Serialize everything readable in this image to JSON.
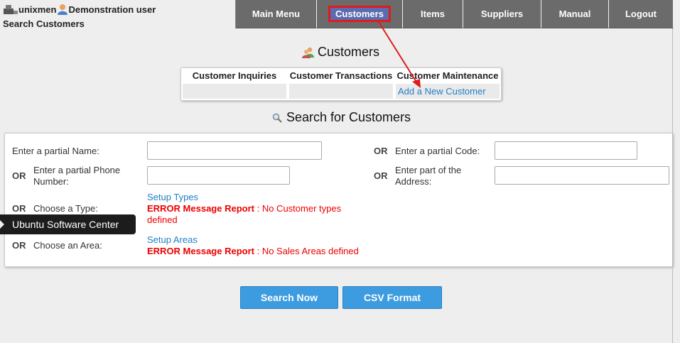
{
  "header": {
    "company": "unixmen",
    "user": "Demonstration user",
    "page_title": "Search Customers"
  },
  "menu": [
    {
      "label": "Main Menu"
    },
    {
      "label": "Customers",
      "highlighted": true
    },
    {
      "label": "Items"
    },
    {
      "label": "Suppliers"
    },
    {
      "label": "Manual"
    },
    {
      "label": "Logout"
    }
  ],
  "customers_panel": {
    "title": "Customers",
    "columns": [
      {
        "header": "Customer Inquiries",
        "cell": ""
      },
      {
        "header": "Customer Transactions",
        "cell": ""
      },
      {
        "header": "Customer Maintenance",
        "cell": "Add a New Customer"
      }
    ]
  },
  "search": {
    "title": "Search for Customers",
    "or_label": "OR",
    "name_label": "Enter a partial Name:",
    "code_label": "Enter a partial Code:",
    "phone_label": "Enter a partial Phone Number:",
    "address_label": "Enter part of the Address:",
    "type_label": "Choose a Type:",
    "type_link": "Setup Types",
    "type_error_title": "ERROR Message Report",
    "type_error_text": " : No Customer types defined",
    "area_label": "Choose an Area:",
    "area_link": "Setup Areas",
    "area_error_title": "ERROR Message Report",
    "area_error_text": " : No Sales Areas defined",
    "name_value": "",
    "code_value": "",
    "phone_value": "",
    "address_value": ""
  },
  "tooltip": "Ubuntu Software Center",
  "buttons": {
    "search_now": "Search Now",
    "csv_format": "CSV Format"
  },
  "colors": {
    "menu_bg": "#6b6b6b",
    "highlight_border": "#e01b1b",
    "link": "#1f7fc8",
    "error": "#e00000",
    "button": "#3d9be0",
    "arrow": "#e01b1b"
  }
}
